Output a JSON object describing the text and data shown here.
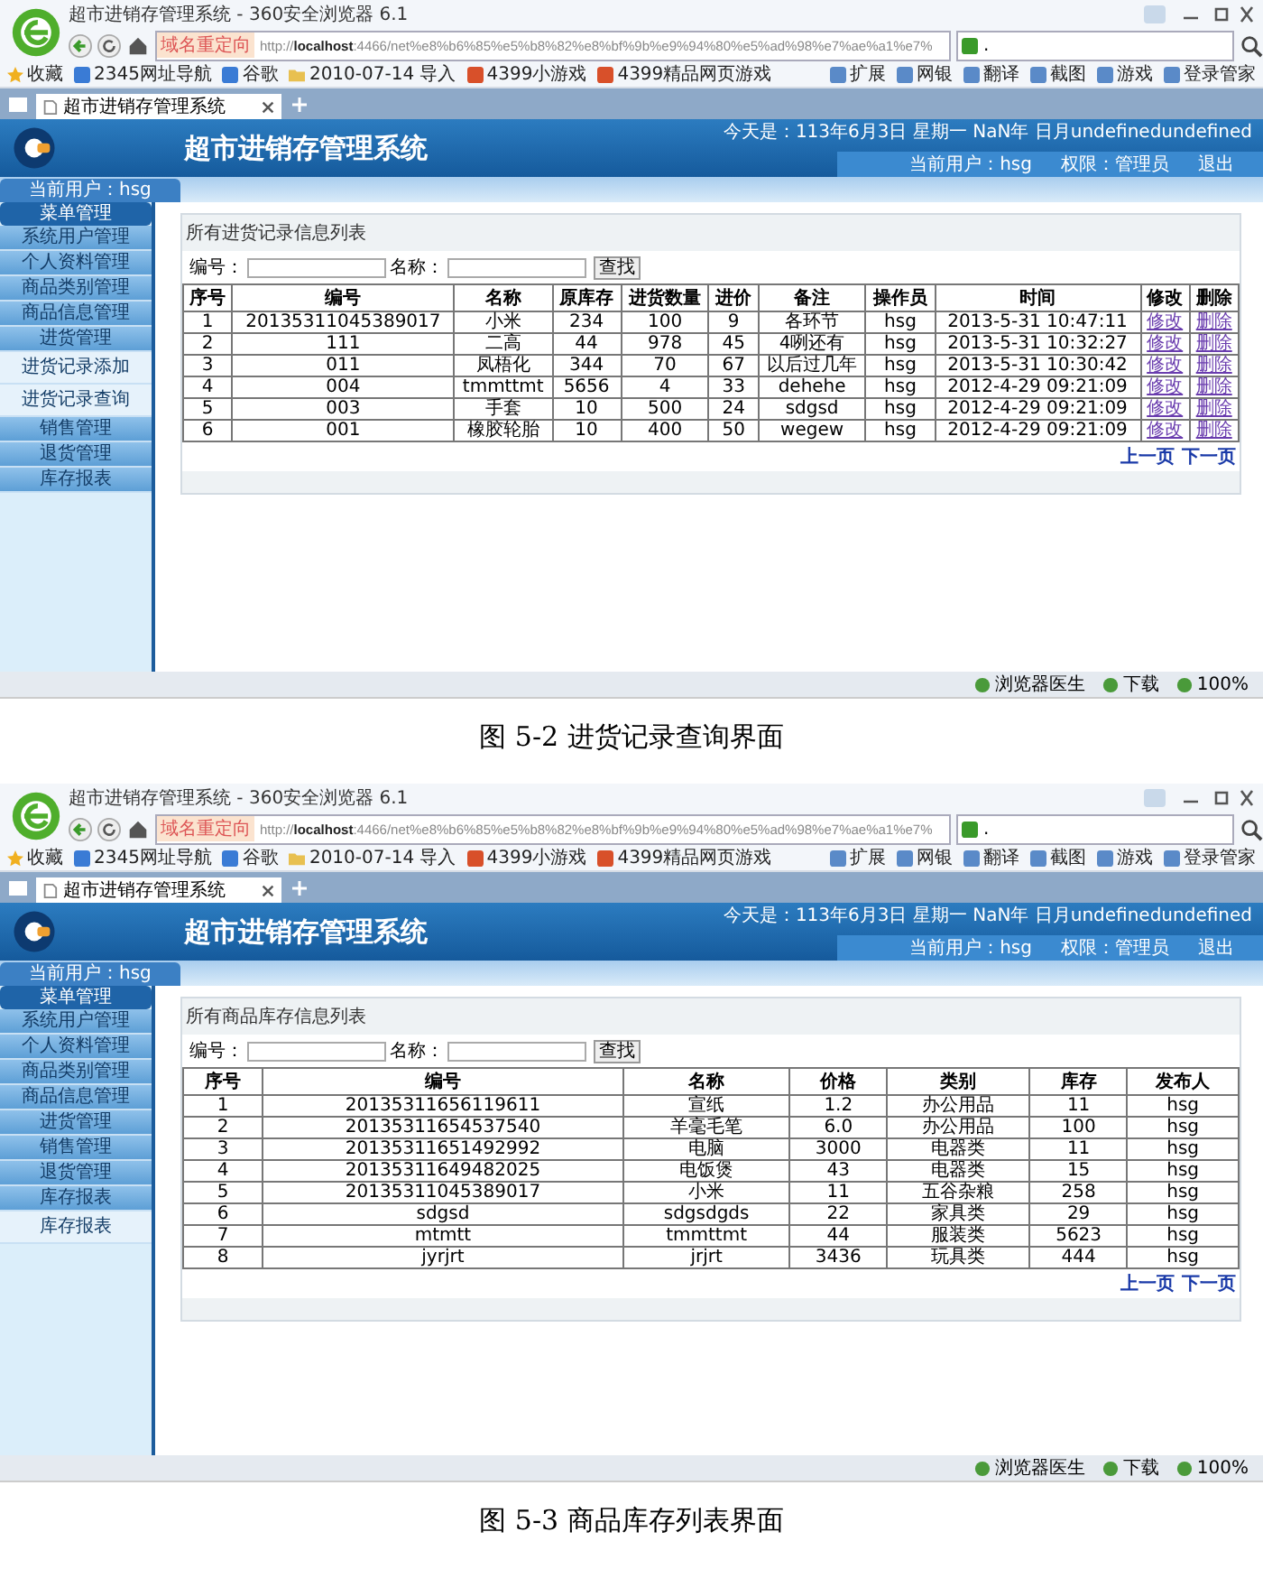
{
  "figures": [
    {
      "browser": {
        "title": "超市进销存管理系统 - 360安全浏览器 6.1",
        "redirect_tag": "域名重定向",
        "url": "http://**localhost**:4466/net%e8%b6%85%e5%b8%82%e8%bf%9b%e9%94%80%e5%ad%98%e7%ae%a1%e7%",
        "search_value": ".",
        "bookmarks": [
          {
            "label": "收藏",
            "kind": "star"
          },
          {
            "label": "2345网址导航",
            "kind": "site"
          },
          {
            "label": "谷歌",
            "kind": "site"
          },
          {
            "label": "2010-07-14 导入",
            "kind": "folder"
          },
          {
            "label": "4399小游戏",
            "kind": "game"
          },
          {
            "label": "4399精品网页游戏",
            "kind": "game"
          }
        ],
        "tools": [
          "扩展",
          "网银",
          "翻译",
          "截图",
          "游戏",
          "登录管家"
        ],
        "tab": "超市进销存管理系统",
        "status": [
          "浏览器医生",
          "下载",
          "100%"
        ]
      },
      "app": {
        "title": "超市进销存管理系统",
        "date": "今天是：113年6月3日 星期一 NaN年 日月undefinedundefined",
        "user": "当前用户：hsg",
        "role": "权限：管理员",
        "logout": "退出",
        "user_tab": "当前用户：hsg",
        "menu_header": "菜单管理",
        "menu": [
          {
            "label": "系统用户管理",
            "kind": "group"
          },
          {
            "label": "个人资料管理",
            "kind": "group"
          },
          {
            "label": "商品类别管理",
            "kind": "group"
          },
          {
            "label": "商品信息管理",
            "kind": "group"
          },
          {
            "label": "进货管理",
            "kind": "group"
          },
          {
            "label": "进货记录添加",
            "kind": "sub"
          },
          {
            "label": "进货记录查询",
            "kind": "sub"
          },
          {
            "label": "销售管理",
            "kind": "group"
          },
          {
            "label": "退货管理",
            "kind": "group"
          },
          {
            "label": "库存报表",
            "kind": "group"
          }
        ],
        "panel_title": "所有进货记录信息列表",
        "filters": [
          "编号：",
          "名称："
        ],
        "search_button": "查找",
        "columns": [
          {
            "label": "序号",
            "kind": "text"
          },
          {
            "label": "编号",
            "kind": "text"
          },
          {
            "label": "名称",
            "kind": "text"
          },
          {
            "label": "原库存",
            "kind": "text"
          },
          {
            "label": "进货数量",
            "kind": "text"
          },
          {
            "label": "进价",
            "kind": "text"
          },
          {
            "label": "备注",
            "kind": "text"
          },
          {
            "label": "操作员",
            "kind": "text"
          },
          {
            "label": "时间",
            "kind": "text"
          },
          {
            "label": "修改",
            "kind": "link"
          },
          {
            "label": "删除",
            "kind": "link"
          }
        ],
        "rows": [
          [
            "1",
            "20135311045389017",
            "小米",
            "234",
            "100",
            "9",
            "各环节",
            "hsg",
            "2013-5-31 10:47:11",
            "修改",
            "删除"
          ],
          [
            "2",
            "111",
            "二高",
            "44",
            "978",
            "45",
            "4咧还有",
            "hsg",
            "2013-5-31 10:32:27",
            "修改",
            "删除"
          ],
          [
            "3",
            "011",
            "凤梧化",
            "344",
            "70",
            "67",
            "以后过几年",
            "hsg",
            "2013-5-31 10:30:42",
            "修改",
            "删除"
          ],
          [
            "4",
            "004",
            "tmmttmt",
            "5656",
            "4",
            "33",
            "dehehe",
            "hsg",
            "2012-4-29 09:21:09",
            "修改",
            "删除"
          ],
          [
            "5",
            "003",
            "手套",
            "10",
            "500",
            "24",
            "sdgsd",
            "hsg",
            "2012-4-29 09:21:09",
            "修改",
            "删除"
          ],
          [
            "6",
            "001",
            "橡胶轮胎",
            "10",
            "400",
            "50",
            "wegew",
            "hsg",
            "2012-4-29 09:21:09",
            "修改",
            "删除"
          ]
        ],
        "pager": [
          "上一页",
          "下一页"
        ]
      },
      "caption": "图 5-2 进货记录查询界面"
    },
    {
      "browser": {
        "title": "超市进销存管理系统 - 360安全浏览器 6.1",
        "redirect_tag": "域名重定向",
        "url": "http://**localhost**:4466/net%e8%b6%85%e5%b8%82%e8%bf%9b%e9%94%80%e5%ad%98%e7%ae%a1%e7%",
        "search_value": ".",
        "bookmarks": [
          {
            "label": "收藏",
            "kind": "star"
          },
          {
            "label": "2345网址导航",
            "kind": "site"
          },
          {
            "label": "谷歌",
            "kind": "site"
          },
          {
            "label": "2010-07-14 导入",
            "kind": "folder"
          },
          {
            "label": "4399小游戏",
            "kind": "game"
          },
          {
            "label": "4399精品网页游戏",
            "kind": "game"
          }
        ],
        "tools": [
          "扩展",
          "网银",
          "翻译",
          "截图",
          "游戏",
          "登录管家"
        ],
        "tab": "超市进销存管理系统",
        "status": [
          "浏览器医生",
          "下载",
          "100%"
        ]
      },
      "app": {
        "title": "超市进销存管理系统",
        "date": "今天是：113年6月3日 星期一 NaN年 日月undefinedundefined",
        "user": "当前用户：hsg",
        "role": "权限：管理员",
        "logout": "退出",
        "user_tab": "当前用户：hsg",
        "menu_header": "菜单管理",
        "menu": [
          {
            "label": "系统用户管理",
            "kind": "group"
          },
          {
            "label": "个人资料管理",
            "kind": "group"
          },
          {
            "label": "商品类别管理",
            "kind": "group"
          },
          {
            "label": "商品信息管理",
            "kind": "group"
          },
          {
            "label": "进货管理",
            "kind": "group"
          },
          {
            "label": "销售管理",
            "kind": "group"
          },
          {
            "label": "退货管理",
            "kind": "group"
          },
          {
            "label": "库存报表",
            "kind": "group"
          },
          {
            "label": "库存报表",
            "kind": "sub"
          }
        ],
        "panel_title": "所有商品库存信息列表",
        "filters": [
          "编号：",
          "名称："
        ],
        "search_button": "查找",
        "columns": [
          {
            "label": "序号",
            "kind": "text"
          },
          {
            "label": "编号",
            "kind": "text"
          },
          {
            "label": "名称",
            "kind": "text"
          },
          {
            "label": "价格",
            "kind": "text"
          },
          {
            "label": "类别",
            "kind": "text"
          },
          {
            "label": "库存",
            "kind": "text"
          },
          {
            "label": "发布人",
            "kind": "text"
          }
        ],
        "rows": [
          [
            "1",
            "20135311656119611",
            "宣纸",
            "1.2",
            "办公用品",
            "11",
            "hsg"
          ],
          [
            "2",
            "20135311654537540",
            "羊毫毛笔",
            "6.0",
            "办公用品",
            "100",
            "hsg"
          ],
          [
            "3",
            "20135311651492992",
            "电脑",
            "3000",
            "电器类",
            "11",
            "hsg"
          ],
          [
            "4",
            "20135311649482025",
            "电饭煲",
            "43",
            "电器类",
            "15",
            "hsg"
          ],
          [
            "5",
            "20135311045389017",
            "小米",
            "11",
            "五谷杂粮",
            "258",
            "hsg"
          ],
          [
            "6",
            "sdgsd",
            "sdgsdgds",
            "22",
            "家具类",
            "29",
            "hsg"
          ],
          [
            "7",
            "mtmtt",
            "tmmttmt",
            "44",
            "服装类",
            "5623",
            "hsg"
          ],
          [
            "8",
            "jyrjrt",
            "jrjrt",
            "3436",
            "玩具类",
            "444",
            "hsg"
          ]
        ],
        "pager": [
          "上一页",
          "下一页"
        ]
      },
      "caption": "图 5-3 商品库存列表界面"
    }
  ]
}
